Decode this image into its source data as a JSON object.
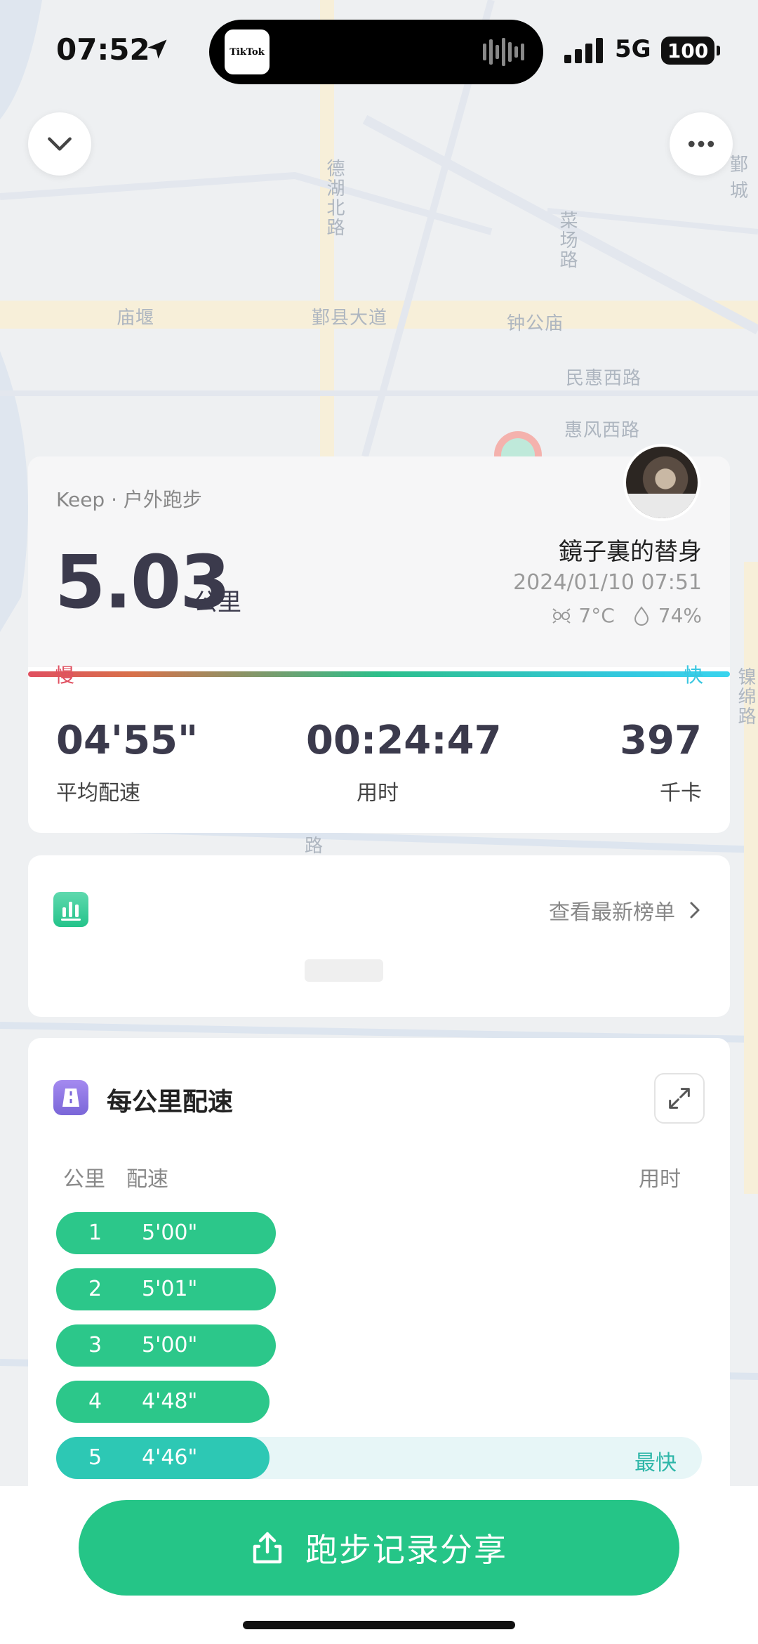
{
  "status_bar": {
    "time": "07:52",
    "app_badge": "TikTok",
    "network": "5G",
    "battery": "100"
  },
  "map": {
    "labels": [
      "德湖北路",
      "菜场路",
      "庙堰",
      "鄞县大道",
      "钟公庙",
      "民惠西路",
      "惠风西路",
      "鄞城",
      "镍绵路",
      "路"
    ]
  },
  "summary": {
    "brand": "Keep · 户外跑步",
    "distance": "5.03",
    "distance_unit": "公里",
    "username": "鏡子裏的替身",
    "datetime": "2024/01/10 07:51",
    "temperature": "7°C",
    "humidity": "74%",
    "pace_slow": "慢",
    "pace_fast": "快",
    "stats": [
      {
        "value": "04'55\"",
        "label": "平均配速"
      },
      {
        "value": "00:24:47",
        "label": "用时"
      },
      {
        "value": "397",
        "label": "千卡"
      }
    ]
  },
  "ranking": {
    "link": "查看最新榜单"
  },
  "splits": {
    "title": "每公里配速",
    "col_km": "公里",
    "col_pace": "配速",
    "col_time": "用时",
    "fastest_tag": "最快",
    "rows": [
      {
        "km": "1",
        "pace": "5'00\"",
        "fraction": 0.34
      },
      {
        "km": "2",
        "pace": "5'01\"",
        "fraction": 0.34
      },
      {
        "km": "3",
        "pace": "5'00\"",
        "fraction": 0.34
      },
      {
        "km": "4",
        "pace": "4'48\"",
        "fraction": 0.33
      },
      {
        "km": "5",
        "pace": "4'46\"",
        "fraction": 0.33,
        "fastest": true
      }
    ]
  },
  "share": {
    "label": "跑步记录分享"
  }
}
